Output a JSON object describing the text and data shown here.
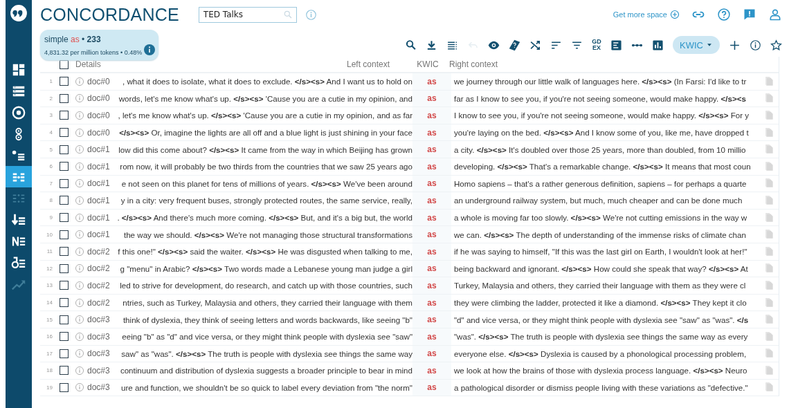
{
  "app": {
    "title": "CONCORDANCE"
  },
  "corpus_search": {
    "value": "TED Talks"
  },
  "header_links": [
    {
      "kind": "text",
      "label": "Get more space"
    },
    {
      "kind": "link"
    },
    {
      "kind": "help"
    },
    {
      "kind": "feedback"
    },
    {
      "kind": "user"
    }
  ],
  "sidebar": {
    "items": [
      {
        "selected": false,
        "disabled": false
      },
      {
        "selected": false,
        "disabled": false
      },
      {
        "selected": false,
        "disabled": false
      },
      {
        "selected": false,
        "disabled": false
      },
      {
        "selected": false,
        "disabled": false
      },
      {
        "selected": true,
        "disabled": false
      },
      {
        "selected": false,
        "disabled": true
      },
      {
        "selected": false,
        "disabled": false
      },
      {
        "selected": false,
        "disabled": false
      },
      {
        "selected": false,
        "disabled": false
      },
      {
        "selected": false,
        "disabled": true
      }
    ]
  },
  "summary": {
    "query_type": "simple",
    "query": "as",
    "separator": "•",
    "hits": "233",
    "frequency": "4,831.32 per million tokens • 0.48%"
  },
  "toolbar": [
    {
      "kind": "icon",
      "disabled": false
    },
    {
      "kind": "icon",
      "disabled": false
    },
    {
      "kind": "icon",
      "disabled": false
    },
    {
      "kind": "icon",
      "disabled": true
    },
    {
      "kind": "icon",
      "disabled": false
    },
    {
      "kind": "icon",
      "disabled": false
    },
    {
      "kind": "icon",
      "disabled": false
    },
    {
      "kind": "icon",
      "disabled": false
    },
    {
      "kind": "icon",
      "disabled": false
    },
    {
      "kind": "text",
      "label": "GD EX",
      "disabled": false
    },
    {
      "kind": "icon",
      "disabled": false
    },
    {
      "kind": "icon",
      "disabled": false
    },
    {
      "kind": "icon",
      "disabled": false
    },
    {
      "kind": "dropdown",
      "label": "KWIC",
      "disabled": false
    },
    {
      "kind": "icon",
      "disabled": false
    },
    {
      "kind": "icon",
      "disabled": false
    },
    {
      "kind": "icon",
      "disabled": false
    }
  ],
  "table": {
    "select_all": {
      "checked": false
    },
    "columns": [
      "Details",
      "Left context",
      "KWIC",
      "Right context"
    ],
    "rows": [
      {
        "number": "1",
        "checked": false,
        "doc": "doc#0",
        "left": ", what it does to isolate, what it does to exclude. **</s><s>** And I want us to hold on",
        "kwic": "as",
        "right": "we journey through our little walk of languages here. **</s><s>** (In Farsi: I'd like to tr"
      },
      {
        "number": "2",
        "checked": false,
        "doc": "doc#0",
        "left": "words, let's me know what's up. **</s><s>** 'Cause you are a cutie in my opinion, and",
        "kwic": "as",
        "right": "far as I know to see you, if you're not seeing someone, would make happy. **</s><s**"
      },
      {
        "number": "3",
        "checked": false,
        "doc": "doc#0",
        "left": ", let's me know what's up. **</s><s>** 'Cause you are a cutie in my opinion, and as far",
        "kwic": "as",
        "right": "I know to see you, if you're not seeing someone, would make happy. **</s><s>** For y"
      },
      {
        "number": "4",
        "checked": false,
        "doc": "doc#0",
        "left": "**</s><s>** Or, imagine the lights are all off and a blue light is just shining in your face",
        "kwic": "as",
        "right": "you're laying on the bed. **</s><s>** And I know some of you, like me, have dropped t"
      },
      {
        "number": "5",
        "checked": false,
        "doc": "doc#1",
        "left": "low did this come about? **</s><s>** It came from the way in which Beijing has grown",
        "kwic": "as",
        "right": "a city. **</s><s>** It's doubled over those 25 years, more than doubled, from 10 millio"
      },
      {
        "number": "6",
        "checked": false,
        "doc": "doc#1",
        "left": "rom now, it will probably be two thirds from the countries that we saw 25 years ago",
        "kwic": "as",
        "right": "developing. **</s><s>** That's a remarkable change. **</s><s>** It means that most coun"
      },
      {
        "number": "7",
        "checked": false,
        "doc": "doc#1",
        "left": "e not seen on this planet for tens of millions of years. **</s><s>** We've been around",
        "kwic": "as",
        "right": "Homo sapiens – that's a rather generous definition, sapiens – for perhaps a quarte"
      },
      {
        "number": "8",
        "checked": false,
        "doc": "doc#1",
        "left": "y in a city: very frequent buses, strongly protected routes, the same service, really,",
        "kwic": "as",
        "right": "an underground railway system, but much, much cheaper and can be done much"
      },
      {
        "number": "9",
        "checked": false,
        "doc": "doc#1",
        "left": ". **</s><s>** And there's much more coming. **</s><s>** But, and it's a big but, the world",
        "kwic": "as",
        "right": "a whole is moving far too slowly. **</s><s>** We're not cutting emissions in the way w"
      },
      {
        "number": "10",
        "checked": false,
        "doc": "doc#1",
        "left": "the way we should. **</s><s>** We're not managing those structural transformations",
        "kwic": "as",
        "right": "we can. **</s><s>** The depth of understanding of the immense risks of climate chan"
      },
      {
        "number": "11",
        "checked": false,
        "doc": "doc#2",
        "left": "f this one!\" **</s><s>** said the waiter. **</s><s>** He was disgusted when talking to me,",
        "kwic": "as",
        "right": "if he was saying to himself, \"If this was the last girl on Earth, I wouldn't look at her!\""
      },
      {
        "number": "12",
        "checked": false,
        "doc": "doc#2",
        "left": "g \"menu\" in Arabic? **</s><s>** Two words made a Lebanese young man judge a girl",
        "kwic": "as",
        "right": "being backward and ignorant. **</s><s>** How could she speak that way? **</s><s>** At"
      },
      {
        "number": "13",
        "checked": false,
        "doc": "doc#2",
        "left": "led to strive for development, do research, and catch up with those countries, such",
        "kwic": "as",
        "right": "Turkey, Malaysia and others, they carried their language with them as they were cl"
      },
      {
        "number": "14",
        "checked": false,
        "doc": "doc#2",
        "left": "ntries, such as Turkey, Malaysia and others, they carried their language with them",
        "kwic": "as",
        "right": "they were climbing the ladder, protected it like a diamond. **</s><s>** They kept it clo"
      },
      {
        "number": "15",
        "checked": false,
        "doc": "doc#3",
        "left": "think of dyslexia, they think of seeing letters and words backwards, like seeing \"b\"",
        "kwic": "as",
        "right": "\"d\" and vice versa, or they might think people with dyslexia see \"saw\" as \"was\". **</s**"
      },
      {
        "number": "16",
        "checked": false,
        "doc": "doc#3",
        "left": "eeing \"b\" as \"d\" and vice versa, or they might think people with dyslexia see \"saw\"",
        "kwic": "as",
        "right": "\"was\". **</s><s>** The truth is people with dyslexia see things the same way as every"
      },
      {
        "number": "17",
        "checked": false,
        "doc": "doc#3",
        "left": "saw\" as \"was\". **</s><s>** The truth is people with dyslexia see things the same way",
        "kwic": "as",
        "right": "everyone else. **</s><s>** Dyslexia is caused by a phonological processing problem,"
      },
      {
        "number": "18",
        "checked": false,
        "doc": "doc#3",
        "left": "continuum and distribution of dyslexia suggests a broader principle to bear in mind",
        "kwic": "as",
        "right": "we look at how the brains of those with dyslexia process language. **</s><s>** Neuro"
      },
      {
        "number": "19",
        "checked": false,
        "doc": "doc#3",
        "left": "ure and function, we shouldn't be so quick to label every deviation from \"the norm\"",
        "kwic": "as",
        "right": "a pathological disorder or dismiss people living with these variations as \"defective.\""
      }
    ]
  }
}
